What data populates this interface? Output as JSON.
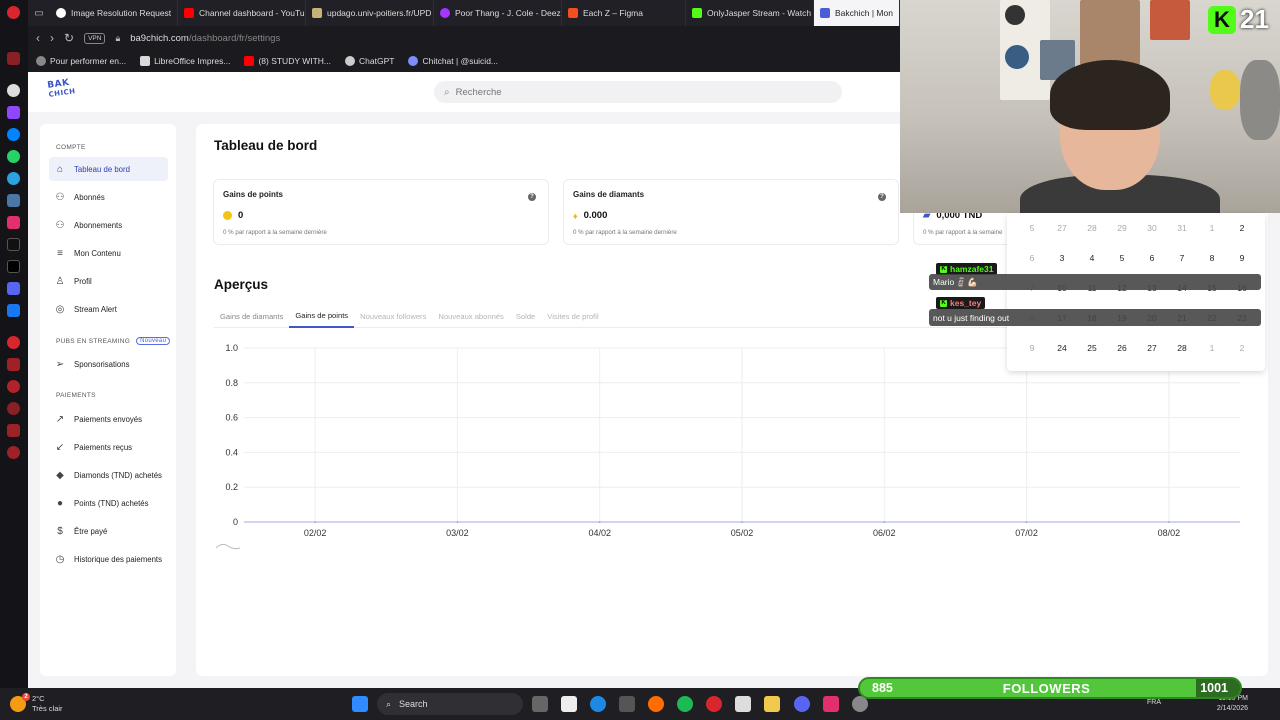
{
  "browser": {
    "tabs": [
      {
        "label": "Image Resolution Request",
        "color": "#ffffff"
      },
      {
        "label": "Channel dashboard - YouTube",
        "color": "#ff0000"
      },
      {
        "label": "updago.univ-poitiers.fr/UPD",
        "color": "#c9b27a"
      },
      {
        "label": "Poor Thang - J. Cole - Deezer",
        "color": "#a238ff"
      },
      {
        "label": "Each Z – Figma",
        "color": "#f24e1e"
      },
      {
        "label": "OnlyJasper Stream - Watch",
        "color": "#53fc18"
      },
      {
        "label": "Bakchich | Mon",
        "color": "#4a5ed8"
      }
    ],
    "vpn": "VPN",
    "url_host": "ba9chich.com",
    "url_path": "/dashboard/fr/settings",
    "bookmarks": [
      {
        "label": "Pour performer en...",
        "color": "#888888"
      },
      {
        "label": "LibreOffice Impres...",
        "color": "#d9d9d9"
      },
      {
        "label": "(8) STUDY WITH...",
        "color": "#ff0000"
      },
      {
        "label": "ChatGPT",
        "color": "#cccccc"
      },
      {
        "label": "Chitchat | @suicid...",
        "color": "#7f8cff"
      }
    ]
  },
  "site": {
    "logo_line1": "BAK",
    "logo_line2": "CHICH",
    "search_placeholder": "Recherche"
  },
  "sidebar": {
    "section_compte": "COMPTE",
    "items_compte": [
      {
        "label": "Tableau de bord",
        "icon": "home-icon"
      },
      {
        "label": "Abonnés",
        "icon": "users-icon"
      },
      {
        "label": "Abonnements",
        "icon": "users-icon"
      },
      {
        "label": "Mon Contenu",
        "icon": "list-icon"
      },
      {
        "label": "Profil",
        "icon": "user-icon"
      },
      {
        "label": "Stream Alert",
        "icon": "target-icon"
      }
    ],
    "section_pubs": "PUBS EN STREAMING",
    "badge_new": "Nouveau",
    "items_pubs": [
      {
        "label": "Sponsorisations",
        "icon": "send-icon"
      }
    ],
    "section_paiements": "PAIEMENTS",
    "items_paiements": [
      {
        "label": "Paiements envoyés",
        "icon": "arrow-up-right-icon"
      },
      {
        "label": "Paiements reçus",
        "icon": "arrow-down-left-icon"
      },
      {
        "label": "Diamonds (TND) achetés",
        "icon": "diamond-icon"
      },
      {
        "label": "Points (TND) achetés",
        "icon": "coin-icon"
      },
      {
        "label": "Être payé",
        "icon": "dollar-icon"
      },
      {
        "label": "Historique des paiements",
        "icon": "history-icon"
      }
    ]
  },
  "main": {
    "title": "Tableau de bord",
    "cards": [
      {
        "title": "Gains de points",
        "value": "0",
        "compare": "0 % par rapport à la semaine dernière"
      },
      {
        "title": "Gains de diamants",
        "value": "0.000",
        "compare": "0 % par rapport à la semaine dernière"
      },
      {
        "title": "",
        "value": "0,000 TND",
        "compare": "0 % par rapport à la semaine"
      }
    ],
    "overview_title": "Aperçus",
    "chart_tabs": [
      "Gains de diamants",
      "Gains de points",
      "Nouveaux followers",
      "Nouveaux abonnés",
      "Solde",
      "Visites de profil"
    ],
    "active_tab_index": 1
  },
  "chart_data": {
    "type": "line",
    "title": "",
    "xlabel": "",
    "ylabel": "",
    "categories": [
      "02/02",
      "03/02",
      "04/02",
      "05/02",
      "06/02",
      "07/02",
      "08/02"
    ],
    "y_ticks": [
      "0",
      "0.2",
      "0.4",
      "0.6",
      "0.8",
      "1.0"
    ],
    "ylim": [
      0,
      1
    ],
    "series": [
      {
        "values": [
          0,
          0,
          0,
          0,
          0,
          0,
          0
        ],
        "color": "#4057c9"
      }
    ],
    "grid": true
  },
  "calendar": {
    "rows": [
      [
        "5",
        "27",
        "28",
        "29",
        "30",
        "31",
        "1",
        "2"
      ],
      [
        "6",
        "3",
        "4",
        "5",
        "6",
        "7",
        "8",
        "9"
      ],
      [
        "7",
        "10",
        "11",
        "12",
        "13",
        "14",
        "15",
        "16"
      ],
      [
        "8",
        "17",
        "18",
        "19",
        "20",
        "21",
        "22",
        "23"
      ],
      [
        "9",
        "24",
        "25",
        "26",
        "27",
        "28",
        "1",
        "2"
      ]
    ]
  },
  "stream_overlay": {
    "kick_count": "21",
    "chat": [
      {
        "user": "hamzafe31",
        "message": "Mario 🗿💪🏻"
      },
      {
        "user": "kes_tey",
        "message": "not u just finding out"
      }
    ],
    "followers_current": "885",
    "followers_label": "FOLLOWERS",
    "followers_goal": "1001",
    "followers_progress": 0.884
  },
  "taskbar": {
    "temperature": "2°C",
    "weather": "Très clair",
    "weather_badge": "2",
    "search_label": "Search",
    "lang": "FRA",
    "time": "11:16 PM",
    "date": "2/14/2026"
  }
}
